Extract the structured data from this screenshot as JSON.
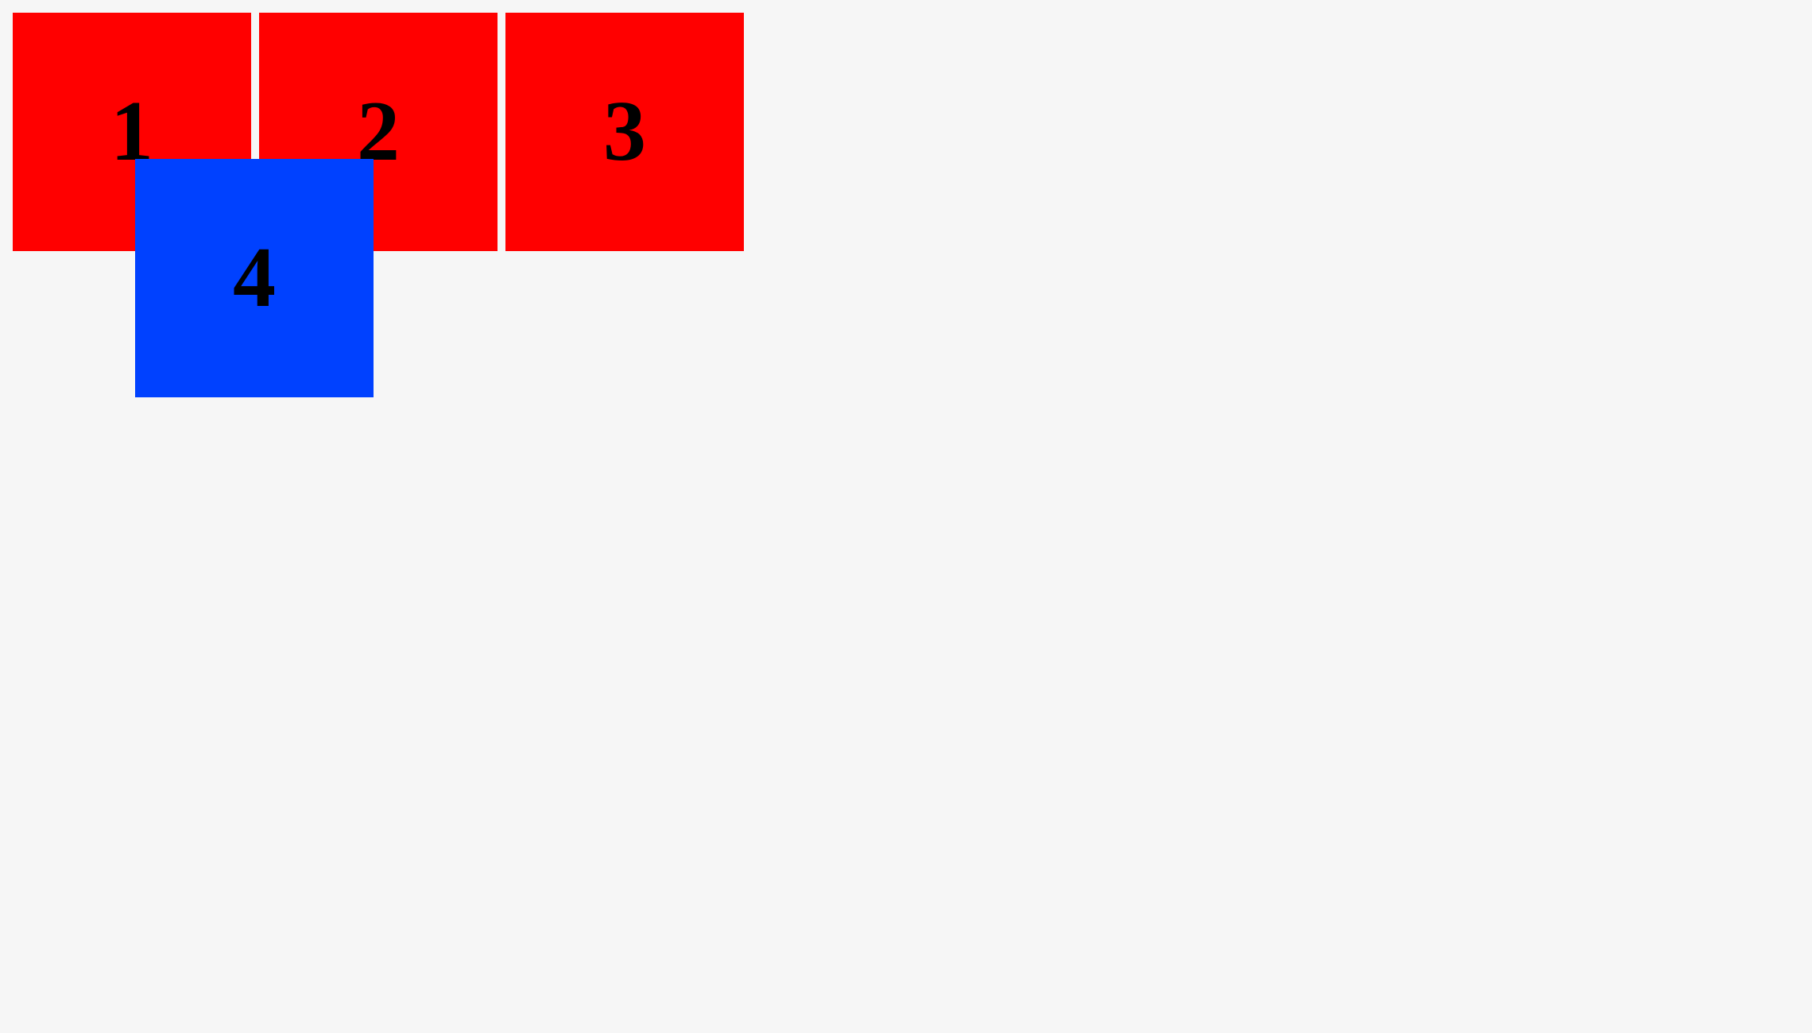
{
  "boxes": [
    {
      "label": "1",
      "color": "#ff0000"
    },
    {
      "label": "2",
      "color": "#ff0000"
    },
    {
      "label": "3",
      "color": "#ff0000"
    },
    {
      "label": "4",
      "color": "#0041ff"
    }
  ],
  "background_color": "#f6f6f6",
  "text_color": "#000000"
}
